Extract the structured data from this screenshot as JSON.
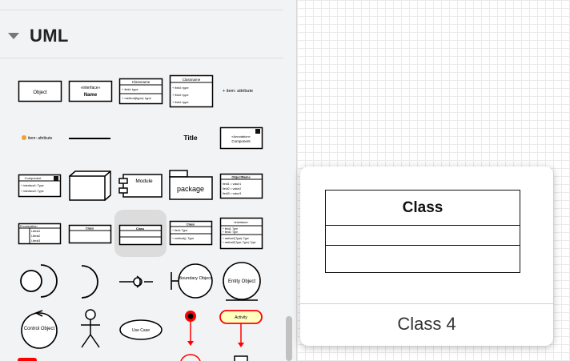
{
  "sidebar": {
    "section": {
      "title": "UML",
      "expanded": true
    },
    "shapes": [
      {
        "name": "object",
        "label": "Object"
      },
      {
        "name": "interface",
        "stereotype": "«interface»",
        "label": "Name"
      },
      {
        "name": "classname",
        "title": "Classname",
        "rows": [
          "+ field: type",
          "+ method(type): type"
        ]
      },
      {
        "name": "classname-3fields",
        "title": "Classname",
        "rows": [
          "+ field: type",
          "+ field: type",
          "+ field: type"
        ]
      },
      {
        "name": "item-attribute",
        "label": "+ item: attribute"
      },
      {
        "name": "item-attribute-icon",
        "label": "item: attribute"
      },
      {
        "name": "title",
        "label": "Title"
      },
      {
        "name": "component",
        "stereotype": "«Annotation»",
        "label": "Component"
      },
      {
        "name": "component-interfaces",
        "title": "Component",
        "rows": [
          "+ interface1: Type",
          "+ interface2: Type"
        ]
      },
      {
        "name": "module",
        "label": "Module"
      },
      {
        "name": "package",
        "label": "package"
      },
      {
        "name": "object-values",
        "title": "ObjectName",
        "rows": [
          "field1 = value1",
          "field2 = value2",
          "field3 = value3"
        ]
      },
      {
        "name": "enumeration",
        "title": "Enumeration",
        "rows": [
          "Literal1",
          "Literal2",
          "Literal3"
        ]
      },
      {
        "name": "class",
        "title": "Class"
      },
      {
        "name": "class-selected",
        "title": "Class"
      },
      {
        "name": "class-methods",
        "title": "Class",
        "rows": [
          "+ field: Type",
          "+ method(): Type"
        ]
      },
      {
        "name": "interface-class",
        "title": "«interface»",
        "rows": [
          "+ field1: Type",
          "+ field2: Type",
          "+ method1(Type): Type",
          "+ method2(Type, Type): Type"
        ]
      },
      {
        "name": "provided-interface",
        "label": ""
      },
      {
        "name": "required-interface",
        "label": ""
      },
      {
        "name": "lollipop",
        "label": ""
      },
      {
        "name": "boundary-object",
        "label": "Boundary Object"
      },
      {
        "name": "entity-object",
        "label": "Entity Object"
      },
      {
        "name": "control-object",
        "label": "Control Object"
      },
      {
        "name": "actor",
        "label": ""
      },
      {
        "name": "use-case",
        "label": "Use Case"
      },
      {
        "name": "initial-state",
        "label": ""
      },
      {
        "name": "activity",
        "label": "Activity"
      }
    ]
  },
  "preview": {
    "shape_title": "Class",
    "caption": "Class 4"
  },
  "colors": {
    "sidebar_bg": "#f2f3f4",
    "selection": "#dcdcdc",
    "activity_fill": "#ffffc0",
    "accent_red": "#ff0000"
  }
}
